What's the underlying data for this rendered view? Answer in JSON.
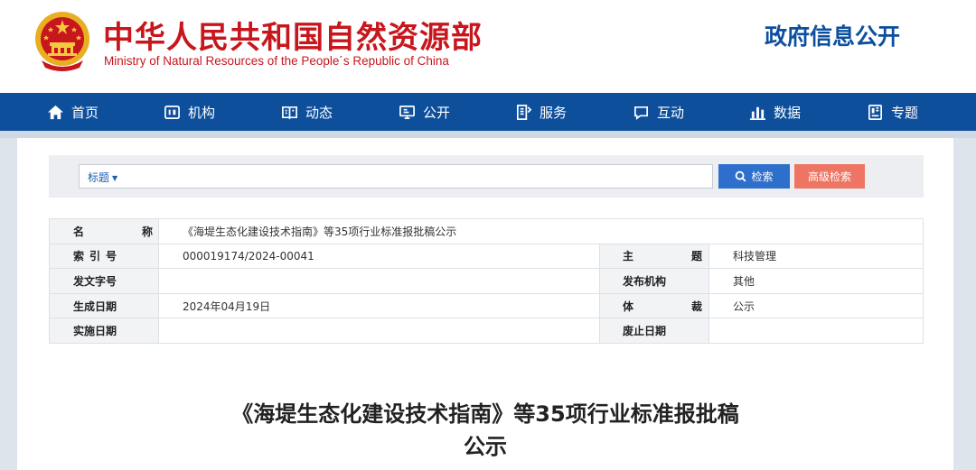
{
  "header": {
    "site_title": "中华人民共和国自然资源部",
    "site_subtitle": "Ministry of Natural Resources of the People´s Republic of China",
    "section_title": "政府信息公开",
    "emblem_icon": "national-emblem-icon"
  },
  "nav": {
    "items": [
      {
        "label": "首页",
        "icon": "home-icon"
      },
      {
        "label": "机构",
        "icon": "organization-icon"
      },
      {
        "label": "动态",
        "icon": "news-icon"
      },
      {
        "label": "公开",
        "icon": "monitor-icon"
      },
      {
        "label": "服务",
        "icon": "document-icon"
      },
      {
        "label": "互动",
        "icon": "chat-icon"
      },
      {
        "label": "数据",
        "icon": "bar-chart-icon"
      },
      {
        "label": "专题",
        "icon": "book-icon"
      }
    ]
  },
  "search": {
    "field_selector": "标题",
    "search_button": "检索",
    "advanced_button": "高级检索"
  },
  "info": {
    "name_label": "名　称",
    "name_value": "《海堤生态化建设技术指南》等35项行业标准报批稿公示",
    "index_label": "索引号",
    "index_value": "000019174/2024-00041",
    "subject_label": "主　题",
    "subject_value": "科技管理",
    "doc_no_label": "发文字号",
    "doc_no_value": "",
    "issuer_label": "发布机构",
    "issuer_value": "其他",
    "created_label": "生成日期",
    "created_value": "2024年04月19日",
    "genre_label": "体　裁",
    "genre_value": "公示",
    "effective_label": "实施日期",
    "effective_value": "",
    "expiry_label": "废止日期",
    "expiry_value": ""
  },
  "article": {
    "title_line1": "《海堤生态化建设技术指南》等35项行业标准报批稿",
    "title_line2": "公示"
  },
  "colors": {
    "brand_red": "#c8161d",
    "nav_blue": "#0e4f9c",
    "search_blue": "#2e6fcb",
    "advanced_red": "#ee7563"
  }
}
